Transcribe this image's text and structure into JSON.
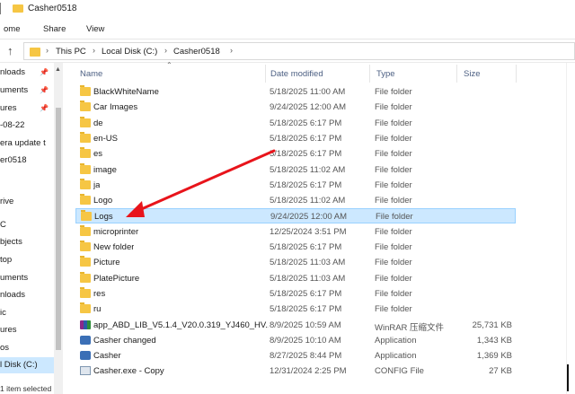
{
  "window": {
    "title": "Casher0518"
  },
  "ribbon": {
    "tabs": [
      "ome",
      "Share",
      "View"
    ]
  },
  "address": {
    "crumbs": [
      "This PC",
      "Local Disk (C:)",
      "Casher0518"
    ]
  },
  "nav": {
    "items": [
      "nloads",
      "uments",
      "ures",
      "-08-22",
      "era update t",
      "er0518",
      "rive",
      "C",
      "bjects",
      "top",
      "uments",
      "nloads",
      "ic",
      "ures",
      "os",
      "l Disk (C:)"
    ],
    "selected_index": 15
  },
  "status": {
    "text": "1 item selected"
  },
  "columns": {
    "name": "Name",
    "date": "Date modified",
    "type": "Type",
    "size": "Size"
  },
  "files": [
    {
      "name": "BlackWhiteName",
      "date": "5/18/2025 11:00 AM",
      "type": "File folder",
      "size": "",
      "icon": "folder-icon"
    },
    {
      "name": "Car Images",
      "date": "9/24/2025 12:00 AM",
      "type": "File folder",
      "size": "",
      "icon": "folder-icon"
    },
    {
      "name": "de",
      "date": "5/18/2025 6:17 PM",
      "type": "File folder",
      "size": "",
      "icon": "folder-icon"
    },
    {
      "name": "en-US",
      "date": "5/18/2025 6:17 PM",
      "type": "File folder",
      "size": "",
      "icon": "folder-icon"
    },
    {
      "name": "es",
      "date": "5/18/2025 6:17 PM",
      "type": "File folder",
      "size": "",
      "icon": "folder-icon"
    },
    {
      "name": "image",
      "date": "5/18/2025 11:02 AM",
      "type": "File folder",
      "size": "",
      "icon": "folder-icon"
    },
    {
      "name": "ja",
      "date": "5/18/2025 6:17 PM",
      "type": "File folder",
      "size": "",
      "icon": "folder-icon"
    },
    {
      "name": "Logo",
      "date": "5/18/2025 11:02 AM",
      "type": "File folder",
      "size": "",
      "icon": "folder-icon"
    },
    {
      "name": "Logs",
      "date": "9/24/2025 12:00 AM",
      "type": "File folder",
      "size": "",
      "icon": "folder-icon",
      "selected": true
    },
    {
      "name": "microprinter",
      "date": "12/25/2024 3:51 PM",
      "type": "File folder",
      "size": "",
      "icon": "folder-icon"
    },
    {
      "name": "New folder",
      "date": "5/18/2025 6:17 PM",
      "type": "File folder",
      "size": "",
      "icon": "folder-icon"
    },
    {
      "name": "Picture",
      "date": "5/18/2025 11:03 AM",
      "type": "File folder",
      "size": "",
      "icon": "folder-icon"
    },
    {
      "name": "PlatePicture",
      "date": "5/18/2025 11:03 AM",
      "type": "File folder",
      "size": "",
      "icon": "folder-icon"
    },
    {
      "name": "res",
      "date": "5/18/2025 6:17 PM",
      "type": "File folder",
      "size": "",
      "icon": "folder-icon"
    },
    {
      "name": "ru",
      "date": "5/18/2025 6:17 PM",
      "type": "File folder",
      "size": "",
      "icon": "folder-icon"
    },
    {
      "name": "app_ABD_LIB_V5.1.4_V20.0.319_YJ460_HV...",
      "date": "8/9/2025 10:59 AM",
      "type": "WinRAR 压缩文件",
      "size": "25,731 KB",
      "icon": "winrar-archive-icon"
    },
    {
      "name": "Casher changed",
      "date": "8/9/2025 10:10 AM",
      "type": "Application",
      "size": "1,343 KB",
      "icon": "application-icon"
    },
    {
      "name": "Casher",
      "date": "8/27/2025 8:44 PM",
      "type": "Application",
      "size": "1,369 KB",
      "icon": "application-icon"
    },
    {
      "name": "Casher.exe - Copy",
      "date": "12/31/2024 2:25 PM",
      "type": "CONFIG File",
      "size": "27 KB",
      "icon": "config-file-icon"
    }
  ],
  "annotation": {
    "color": "#e8141b"
  }
}
